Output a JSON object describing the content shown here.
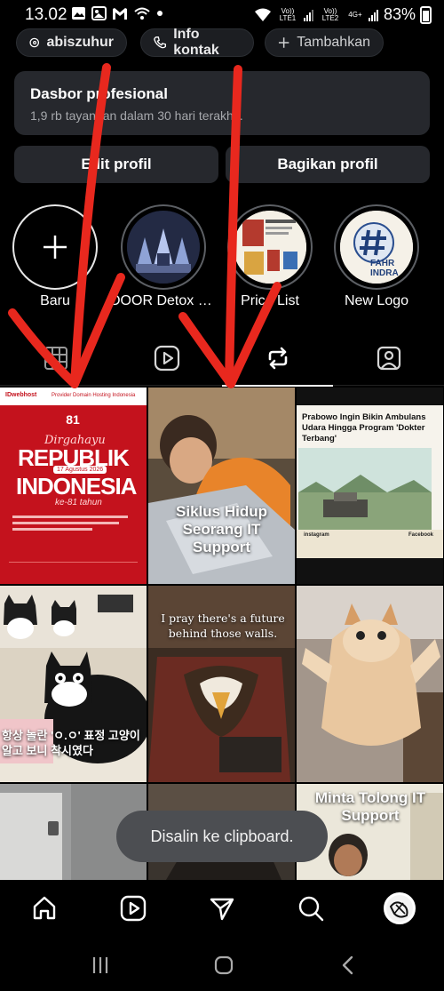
{
  "status_bar": {
    "time": "13.02",
    "sim1": "Vo)) LTE1",
    "sim2": "Vo)) LTE2",
    "net2": "4G+",
    "battery": "83%",
    "left_icons": [
      "photo-icon",
      "gallery-icon",
      "gmail-icon",
      "wifi-call-icon",
      "dot-icon"
    ]
  },
  "chips": {
    "threads_label": "abiszuhur",
    "contact_label": "Info kontak",
    "add_label": "Tambahkan"
  },
  "dashboard": {
    "title": "Dasbor profesional",
    "subtitle": "1,9 rb tayangan dalam 30 hari terakhir."
  },
  "actions": {
    "edit": "Edit profil",
    "share": "Bagikan profil"
  },
  "highlights": [
    {
      "label": "Baru"
    },
    {
      "label": "DOOR Detox JKT..."
    },
    {
      "label": "Price List"
    },
    {
      "label": "New Logo"
    }
  ],
  "highlight_logo_text": "FAHR INDRA",
  "tabs": [
    "grid-tab",
    "reels-tab",
    "reposts-tab",
    "tagged-tab"
  ],
  "active_tab": 2,
  "posts": {
    "p1": {
      "brand": "IDwebhost",
      "brand_tag": "Provider Domain Hosting Indonesia",
      "script": "Dirgahayu",
      "big1": "REPUBLIK",
      "big2": "INDONESIA",
      "date": "17 Agustus 2026",
      "years": "ke-81 tahun"
    },
    "p2": {
      "caption": "Siklus Hidup Seorang IT Support"
    },
    "p3": {
      "headline": "Prabowo Ingin Bikin Ambulans Udara Hingga Program 'Dokter Terbang'",
      "foot_left": "instagram",
      "foot_right": "Facebook"
    },
    "p4": {
      "caption": "항상 놀란 'ㅇ.ㅇ' 표정 고양이 알고 보니 착시였다"
    },
    "p5": {
      "caption": "I pray there's a future behind those walls."
    },
    "p6": {},
    "p7": {},
    "p8": {},
    "p9": {
      "caption": "Minta Tolong IT Support"
    }
  },
  "toast": "Disalin ke clipboard.",
  "bottom_nav": [
    "home-icon",
    "reels-icon",
    "direct-icon",
    "search-icon",
    "profile-avatar"
  ],
  "system_nav": [
    "recent-apps-icon",
    "home-pill-icon",
    "back-icon"
  ],
  "colors": {
    "background": "#000000",
    "card": "#26282d",
    "chip": "#1c1e22",
    "toast": "#4c4e52",
    "annotation_red": "#e8281e",
    "idweb_red": "#c4121d"
  }
}
